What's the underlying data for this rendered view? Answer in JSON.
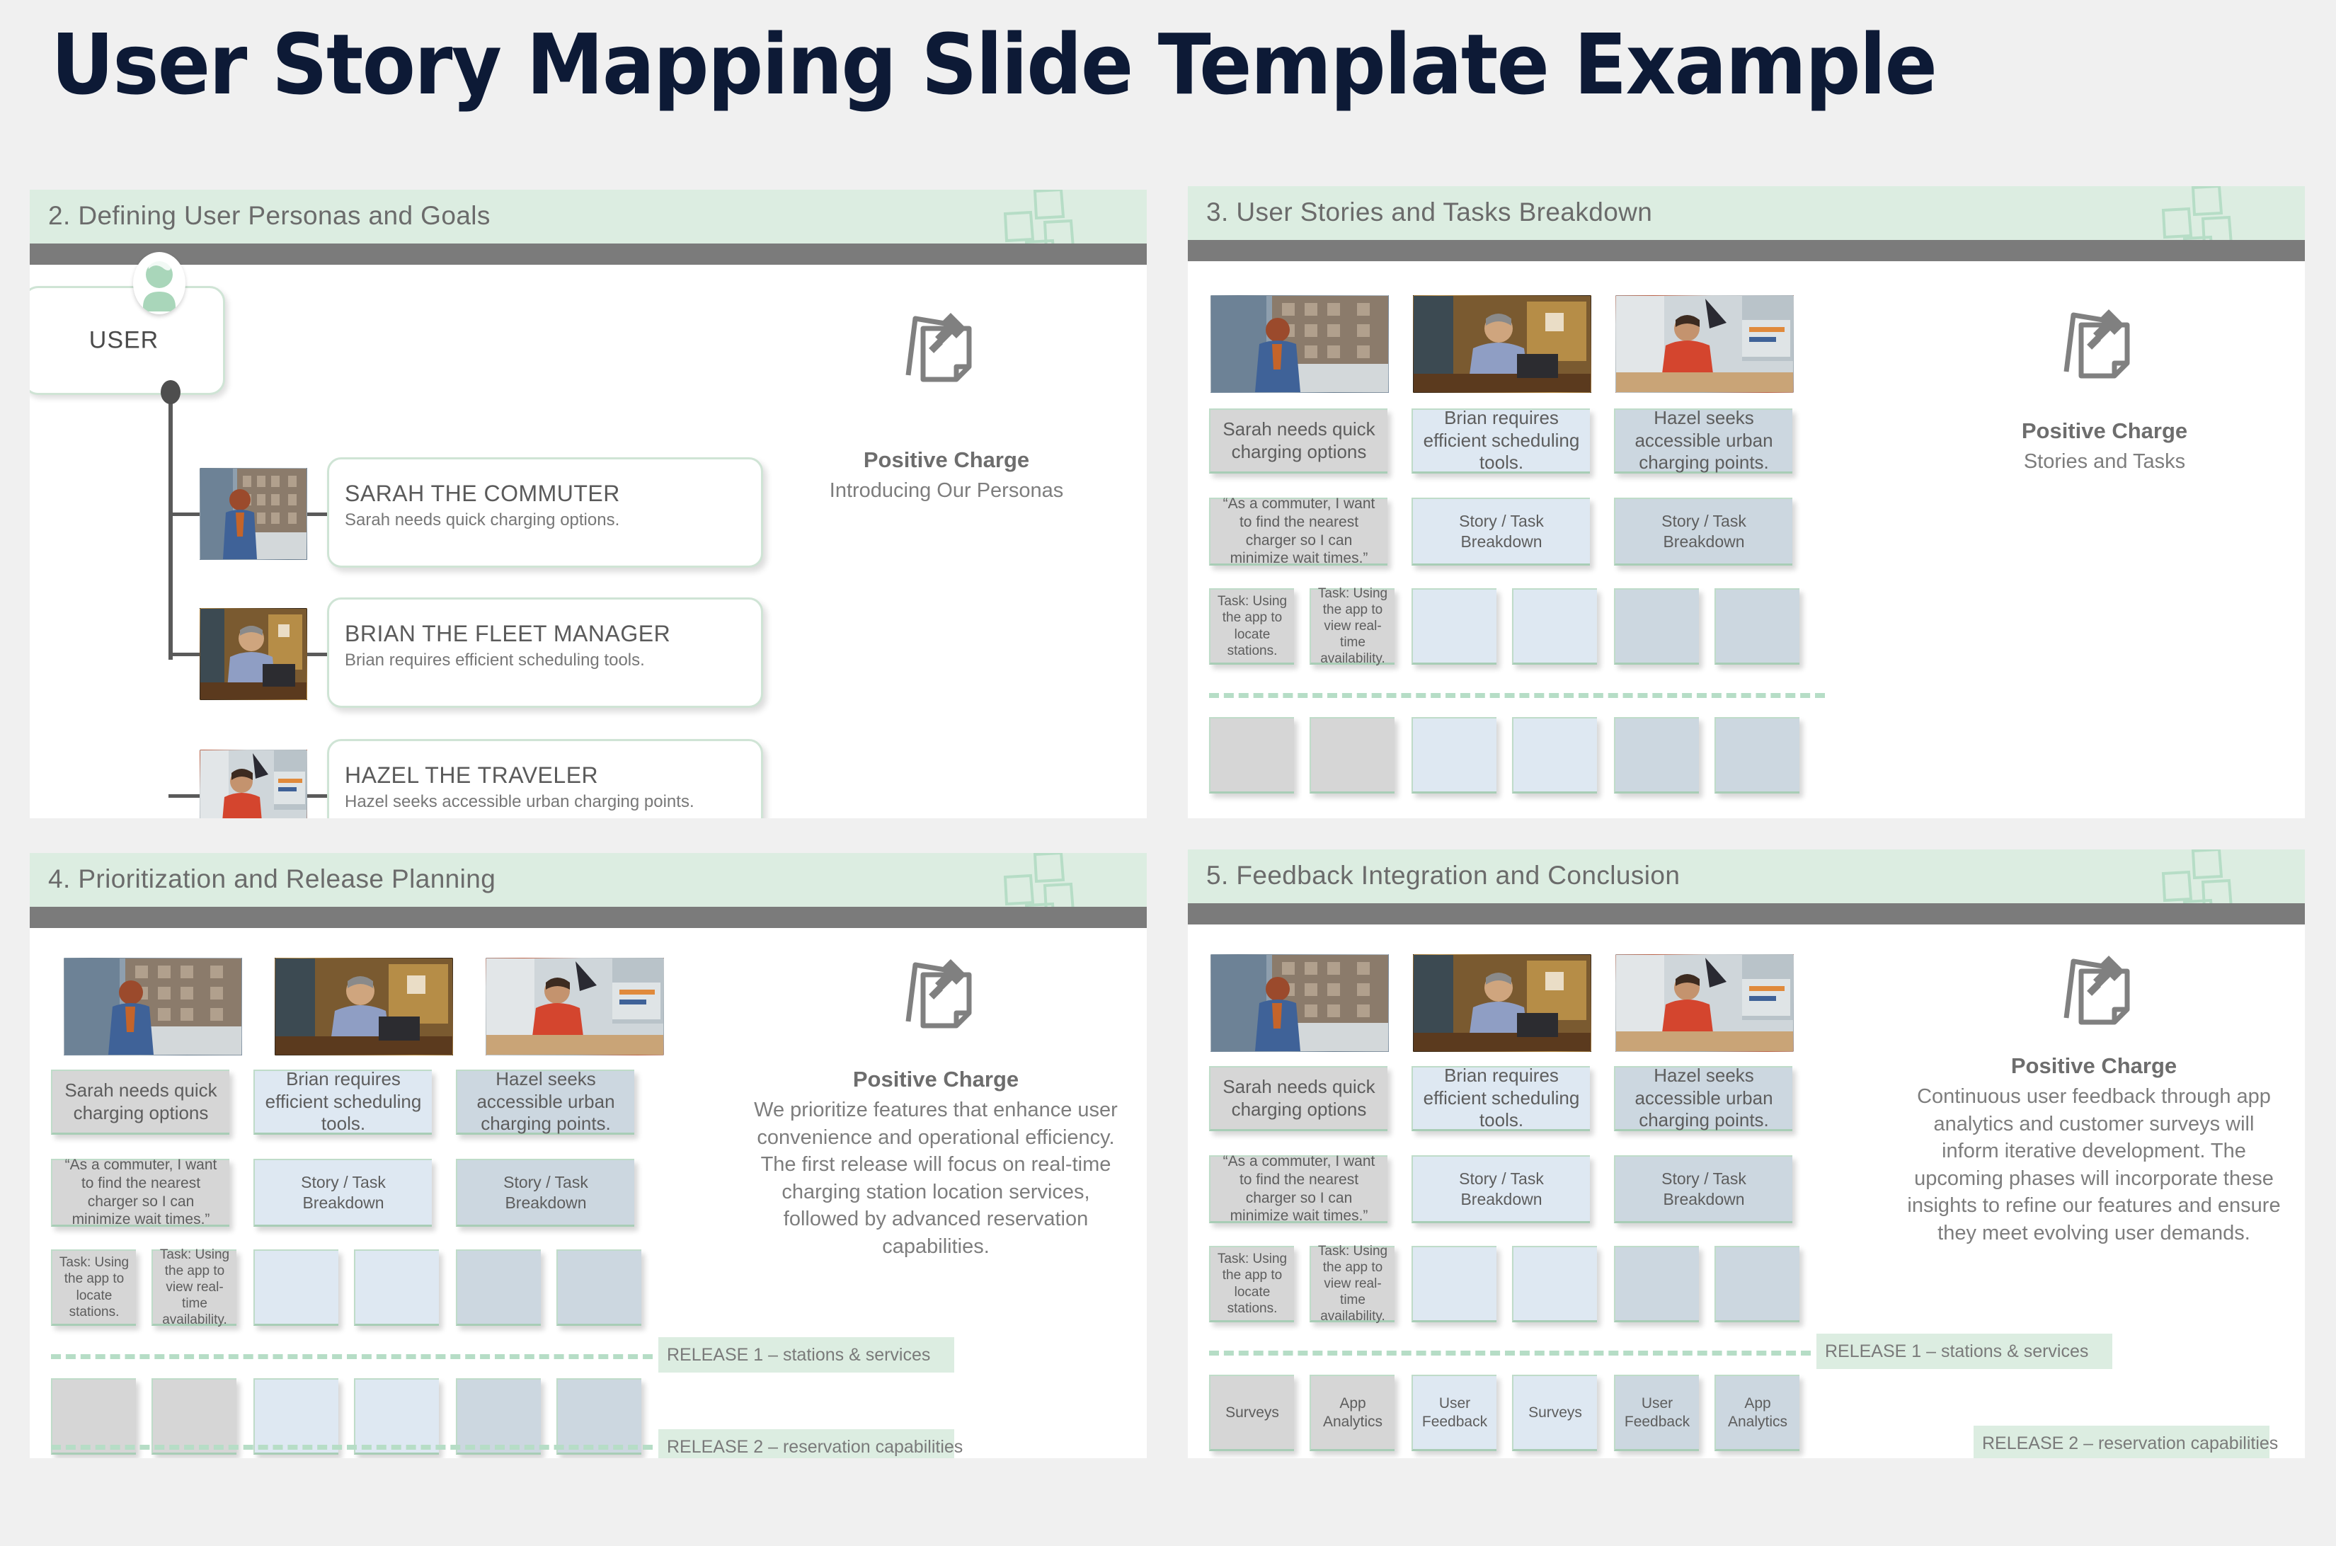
{
  "page": {
    "title": "User Story Mapping Slide Template Example",
    "background": "#f0f0f0",
    "title_color": "#0d1a36",
    "accent_green": "#dcede1",
    "bar_gray": "#7b7b7b",
    "card_gray": "#d6d6d6",
    "card_blue": "#dee8f2",
    "card_bluegray": "#ccd7e0"
  },
  "panel1": {
    "heading": "2. Defining User Personas and Goals",
    "root_label": "USER",
    "personas": [
      {
        "name": "SARAH THE COMMUTER",
        "desc": "Sarah needs quick charging options."
      },
      {
        "name": "BRIAN THE FLEET MANAGER",
        "desc": "Brian requires efficient scheduling tools."
      },
      {
        "name": "HAZEL THE TRAVELER",
        "desc": "Hazel seeks accessible urban charging points."
      }
    ],
    "brand_title": "Positive Charge",
    "brand_body": "Introducing Our Personas"
  },
  "panel2": {
    "heading": "3. User Stories and Tasks Breakdown",
    "brand_title": "Positive Charge",
    "brand_body": "Stories and Tasks",
    "persona_cards": [
      "Sarah needs quick charging options",
      "Brian requires efficient scheduling tools.",
      "Hazel seeks accessible urban charging points."
    ],
    "story_cards": [
      "“As a commuter, I want to find the nearest charger so I can minimize wait times.”",
      "Story / Task Breakdown",
      "Story / Task Breakdown"
    ],
    "task_cards": [
      "Task: Using the app to locate stations.",
      "Task: Using the app to view real-time availability.",
      "",
      "",
      "",
      ""
    ],
    "bottom_cards": [
      "",
      "",
      "",
      "",
      "",
      ""
    ]
  },
  "panel3": {
    "heading": "4. Prioritization and Release Planning",
    "brand_title": "Positive Charge",
    "brand_body": "We prioritize features that enhance user convenience and operational efficiency. The first release will focus on real-time charging station location services, followed by advanced reservation capabilities.",
    "persona_cards": [
      "Sarah needs quick charging options",
      "Brian requires efficient scheduling tools.",
      "Hazel seeks accessible urban charging points."
    ],
    "story_cards": [
      "“As a commuter, I want to find the nearest charger so I can minimize wait times.”",
      "Story / Task Breakdown",
      "Story / Task Breakdown"
    ],
    "task_cards": [
      "Task: Using the app to locate stations.",
      "Task: Using the app to view real-time availability.",
      "",
      "",
      "",
      ""
    ],
    "bottom_cards": [
      "",
      "",
      "",
      "",
      "",
      ""
    ],
    "release1": "RELEASE 1 – stations & services",
    "release2": "RELEASE 2 – reservation capabilities"
  },
  "panel4": {
    "heading": "5. Feedback Integration and Conclusion",
    "brand_title": "Positive Charge",
    "brand_body": "Continuous user feedback through app analytics and customer surveys will inform iterative development. The upcoming phases will incorporate these insights to refine our features and ensure they meet evolving user demands.",
    "persona_cards": [
      "Sarah needs quick charging options",
      "Brian requires efficient scheduling tools.",
      "Hazel seeks accessible urban charging points."
    ],
    "story_cards": [
      "“As a commuter, I want to find the nearest charger so I can minimize wait times.”",
      "Story / Task Breakdown",
      "Story / Task Breakdown"
    ],
    "task_cards": [
      "Task: Using the app to locate stations.",
      "Task: Using the app to view real-time availability.",
      "",
      "",
      "",
      ""
    ],
    "bottom_cards": [
      "Surveys",
      "App Analytics",
      "User Feedback",
      "Surveys",
      "User Feedback",
      "App Analytics"
    ],
    "release1": "RELEASE 1 – stations & services",
    "release2": "RELEASE 2 – reservation capabilities"
  },
  "icons": {
    "notes_deco": "sticky-notes-outline-icon",
    "pin_note": "pinned-note-icon",
    "user_avatar": "user-avatar-icon"
  }
}
